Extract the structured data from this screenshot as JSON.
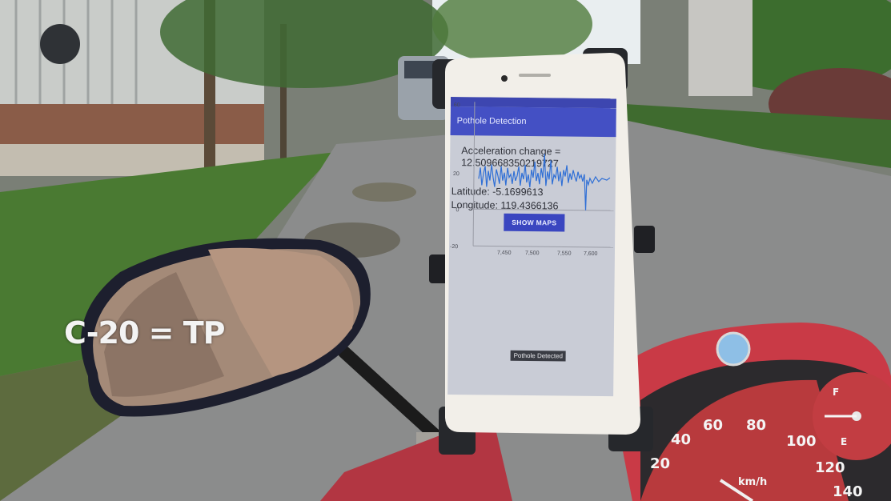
{
  "overlay": {
    "caption": "C-20 = TP"
  },
  "phone": {
    "app_title": "Pothole Detection",
    "acceleration_label": "Acceleration change =",
    "acceleration_value": "12.509668350219727",
    "latitude_text": "Latitude: -5.1699613",
    "longitude_text": "Longitude: 119.4366136",
    "show_maps_label": "SHOW MAPS",
    "pothole_label": "Pothole Detected",
    "y_ticks": [
      "60",
      "20",
      "0",
      "-20"
    ],
    "x_ticks": [
      "7,450",
      "7,500",
      "7,550",
      "7,600"
    ]
  },
  "speedometer": {
    "unit": "km/h",
    "numbers": [
      "20",
      "40",
      "60",
      "80",
      "100",
      "120",
      "140"
    ],
    "fuel_full": "F",
    "fuel_empty": "E"
  },
  "colors": {
    "app_bar": "#4450c4",
    "signal_line": "#2f6fd6",
    "road": "#8b8c8c",
    "scooter_red": "#c93a46"
  }
}
